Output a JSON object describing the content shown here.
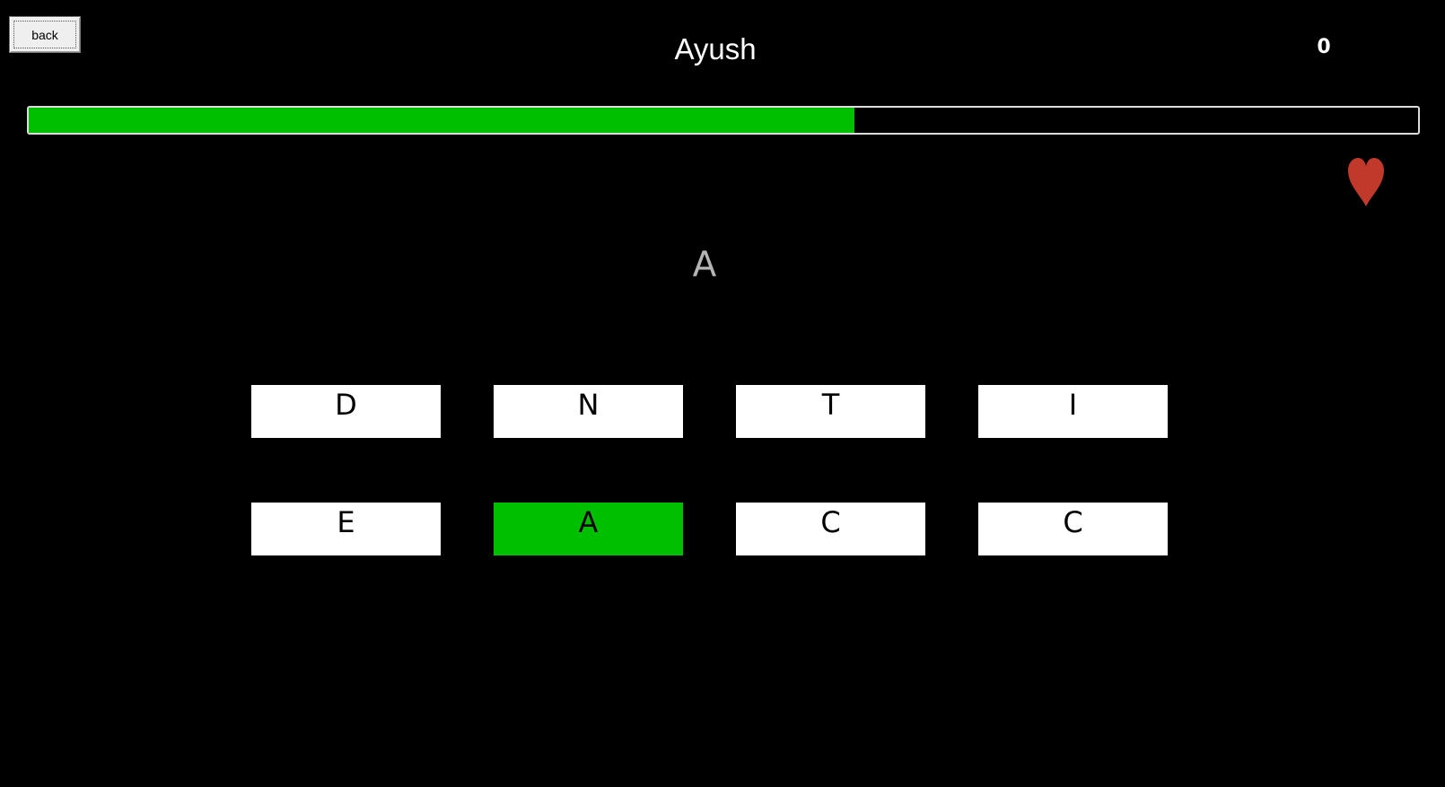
{
  "toolbar": {
    "back_label": "back"
  },
  "header": {
    "player_name": "Ayush",
    "score": "0"
  },
  "progress": {
    "fraction": 0.594,
    "fill_color": "#00bf00"
  },
  "lives": {
    "icon": "heart-icon",
    "color": "#c0392b",
    "count": 1
  },
  "prompt": {
    "letter": "A"
  },
  "options": [
    {
      "label": "D",
      "selected": false
    },
    {
      "label": "N",
      "selected": false
    },
    {
      "label": "T",
      "selected": false
    },
    {
      "label": "I",
      "selected": false
    },
    {
      "label": "E",
      "selected": false
    },
    {
      "label": "A",
      "selected": true
    },
    {
      "label": "C",
      "selected": false
    },
    {
      "label": "C",
      "selected": false
    }
  ],
  "colors": {
    "background": "#000000",
    "selected": "#00bf00",
    "option": "#ffffff"
  }
}
